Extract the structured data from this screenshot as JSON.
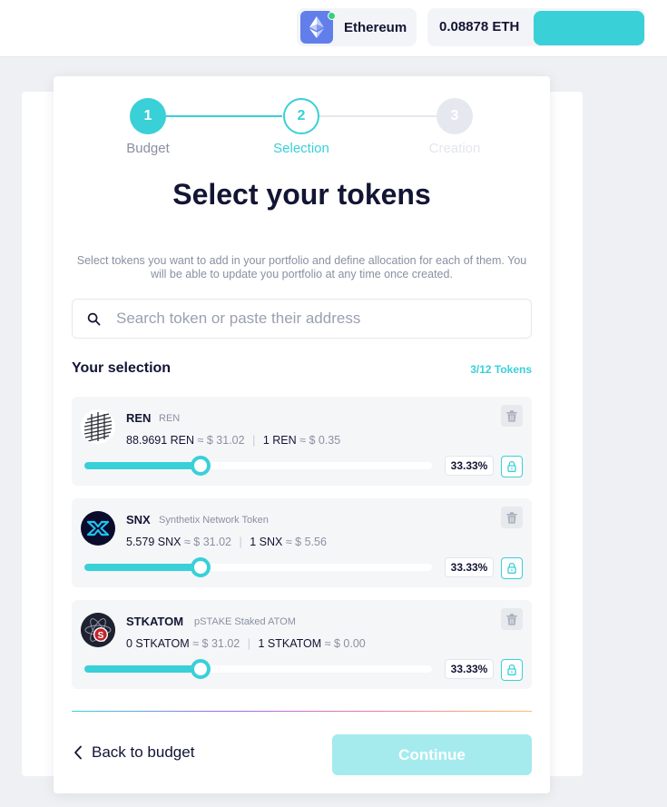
{
  "header": {
    "network_name": "Ethereum",
    "network_icon": "ethereum-diamond-icon",
    "network_status_color": "#2ed47a",
    "balance": "0.08878 ETH",
    "wallet_button_color": "#39d0d8"
  },
  "stepper": {
    "steps": [
      {
        "number": "1",
        "label": "Budget",
        "state": "completed"
      },
      {
        "number": "2",
        "label": "Selection",
        "state": "active"
      },
      {
        "number": "3",
        "label": "Creation",
        "state": "upcoming"
      }
    ]
  },
  "main": {
    "title": "Select your tokens",
    "subtitle": "Select tokens you want to add in your portfolio and define allocation for each of them. You will be able to update you portfolio at any time once created.",
    "search": {
      "placeholder": "Search token or paste their address",
      "value": ""
    },
    "selection_title": "Your selection",
    "selection_count": "3/12 Tokens"
  },
  "tokens": [
    {
      "symbol": "REN",
      "name": "REN",
      "icon": "ren-logo-icon",
      "amount": "88.9691 REN",
      "amount_usd": "≈ $ 31.02",
      "unit_price_label": "1 REN",
      "unit_price": "≈ $ 0.35",
      "allocation": "33.33%",
      "slider_fraction": 0.333
    },
    {
      "symbol": "SNX",
      "name": "Synthetix Network Token",
      "icon": "synthetix-logo-icon",
      "amount": "5.579 SNX",
      "amount_usd": "≈ $ 31.02",
      "unit_price_label": "1 SNX",
      "unit_price": "≈ $ 5.56",
      "allocation": "33.33%",
      "slider_fraction": 0.333
    },
    {
      "symbol": "STKATOM",
      "name": "pSTAKE Staked ATOM",
      "icon": "stkatom-logo-icon",
      "amount": "0 STKATOM",
      "amount_usd": "≈ $ 31.02",
      "unit_price_label": "1 STKATOM",
      "unit_price": "≈ $ 0.00",
      "allocation": "33.33%",
      "slider_fraction": 0.333
    }
  ],
  "footer": {
    "back_label": "Back to budget",
    "continue_label": "Continue"
  },
  "colors": {
    "accent": "#39d0d8",
    "text": "#121533",
    "muted": "#8a90a2"
  }
}
